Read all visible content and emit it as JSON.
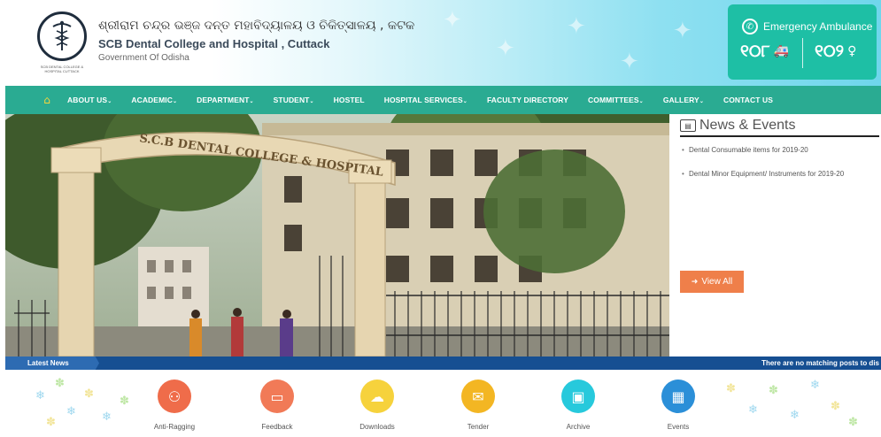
{
  "header": {
    "title_odia": "ଶ୍ରୀରାମ ଚନ୍ଦ୍ର ଭଞ୍ଜ ଦନ୍ତ ମହାବିଦ୍ୟାଳୟ ଓ ଚିକିତ୍ସାଳୟ , କଟକ",
    "title_en": "SCB Dental College and Hospital , Cuttack",
    "subtitle": "Government Of Odisha",
    "logo_caption": "SCB DENTAL COLLEGE & HOSPITAL CUTTACK"
  },
  "emergency": {
    "label": "Emergency Ambulance",
    "number1": "୧୦୮",
    "number2": "୧୦୨"
  },
  "nav": {
    "home_icon": "home-icon",
    "items": [
      {
        "label": "ABOUT US",
        "dropdown": true
      },
      {
        "label": "ACADEMIC",
        "dropdown": true
      },
      {
        "label": "DEPARTMENT",
        "dropdown": true
      },
      {
        "label": "STUDENT",
        "dropdown": true
      },
      {
        "label": "HOSTEL",
        "dropdown": false
      },
      {
        "label": "HOSPITAL SERVICES",
        "dropdown": true
      },
      {
        "label": "FACULTY DIRECTORY",
        "dropdown": false
      },
      {
        "label": "COMMITTEES",
        "dropdown": true
      },
      {
        "label": "GALLERY",
        "dropdown": true
      },
      {
        "label": "CONTACT US",
        "dropdown": false
      }
    ]
  },
  "hero": {
    "arch_text": "S.C.B DENTAL COLLEGE & HOSPITAL"
  },
  "news": {
    "heading": "News & Events",
    "items": [
      "Dental Consumable items for 2019-20",
      "Dental Minor Equipment/ Instruments for 2019-20"
    ],
    "view_all": "View All"
  },
  "ticker": {
    "label": "Latest News",
    "message": "There are no matching posts to dis"
  },
  "quick_links": [
    {
      "label": "Anti-Ragging",
      "icon": "people-icon",
      "color": "#ef6c4a"
    },
    {
      "label": "Feedback",
      "icon": "monitor-icon",
      "color": "#f17a57"
    },
    {
      "label": "Downloads",
      "icon": "cloud-icon",
      "color": "#f6d23c"
    },
    {
      "label": "Tender",
      "icon": "envelope-icon",
      "color": "#f3b623"
    },
    {
      "label": "Archive",
      "icon": "document-icon",
      "color": "#27c9dc"
    },
    {
      "label": "Events",
      "icon": "calendar-icon",
      "color": "#2b8fd8"
    }
  ],
  "colors": {
    "nav_bg": "#2aab92",
    "emergency_bg": "#1ebfa5",
    "ticker_bg": "#164f92",
    "view_all_bg": "#ef7f4a"
  }
}
